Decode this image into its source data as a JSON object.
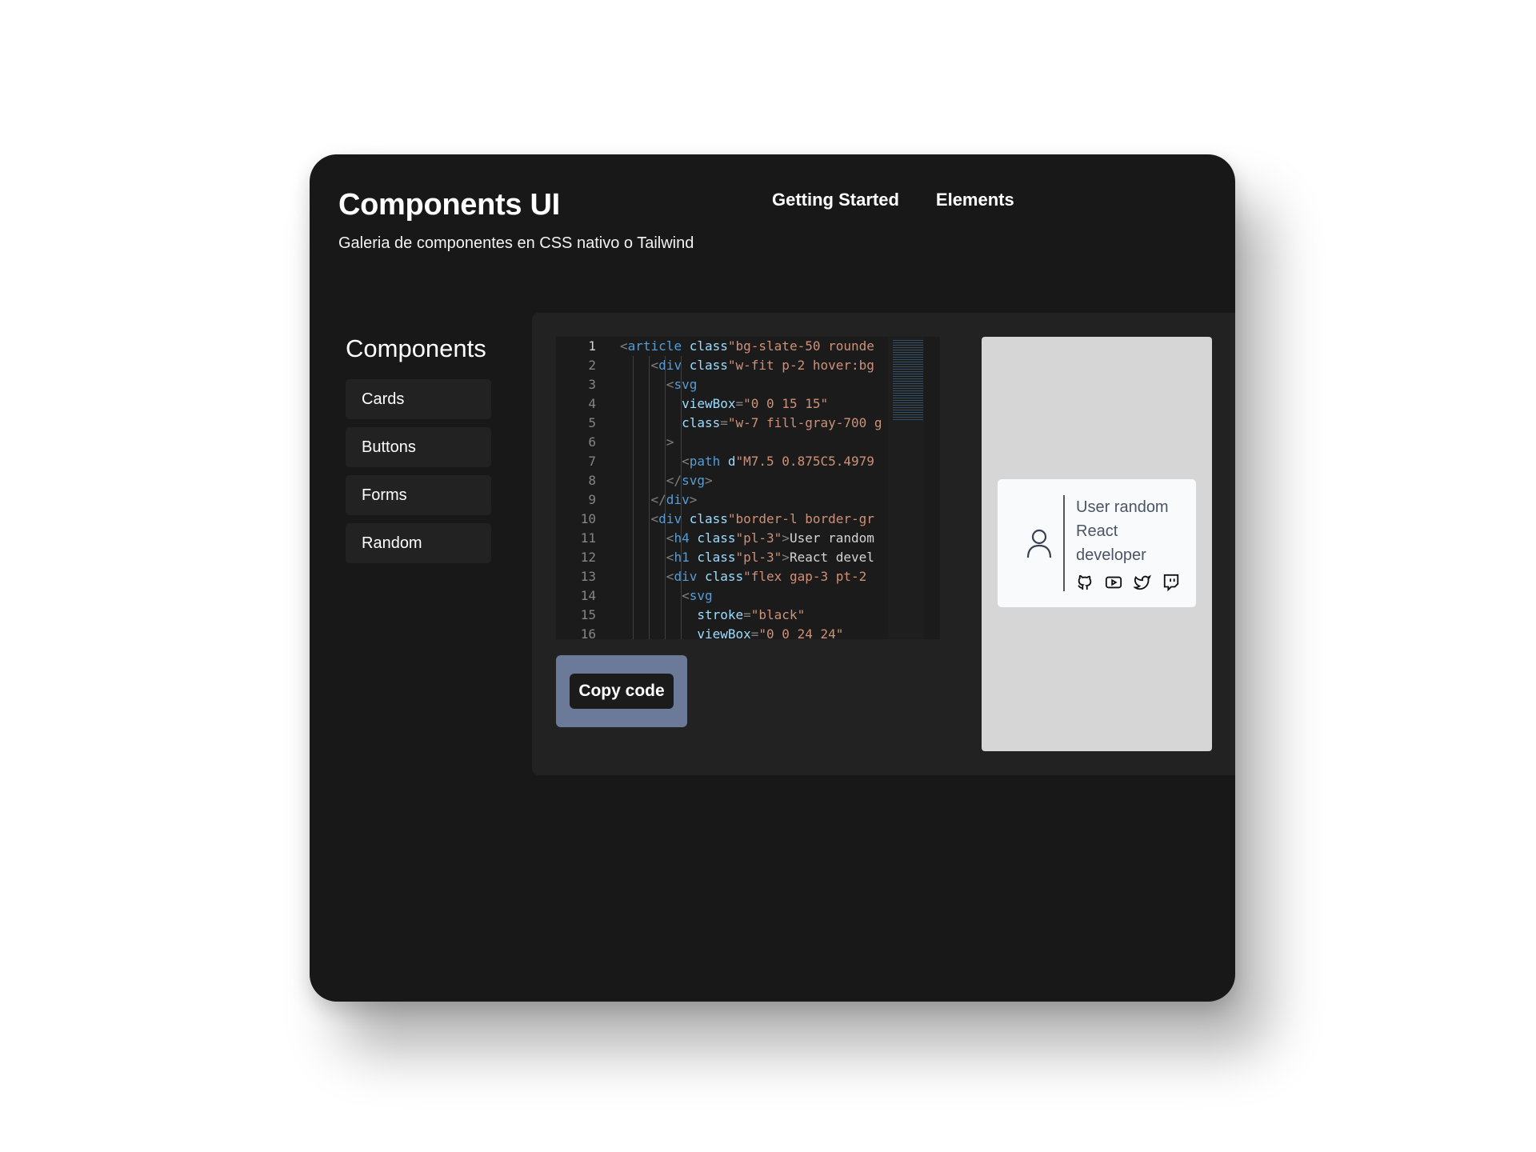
{
  "header": {
    "title": "Components UI",
    "subtitle": "Galeria de componentes en CSS nativo o Tailwind"
  },
  "nav": [
    {
      "label": "Getting Started"
    },
    {
      "label": "Elements"
    }
  ],
  "sidebar": {
    "heading": "Components",
    "items": [
      {
        "label": "Cards"
      },
      {
        "label": "Buttons"
      },
      {
        "label": "Forms"
      },
      {
        "label": "Random"
      }
    ]
  },
  "code": {
    "lines": [
      {
        "n": "1",
        "text": "<article class=\"bg-slate-50 rounde"
      },
      {
        "n": "2",
        "text": "    <div class=\"w-fit p-2 hover:bg"
      },
      {
        "n": "3",
        "text": "      <svg"
      },
      {
        "n": "4",
        "text": "        viewBox=\"0 0 15 15\""
      },
      {
        "n": "5",
        "text": "        class=\"w-7 fill-gray-700 g"
      },
      {
        "n": "6",
        "text": "      >"
      },
      {
        "n": "7",
        "text": "        <path d=\"M7.5 0.875C5.4979"
      },
      {
        "n": "8",
        "text": "      </svg>"
      },
      {
        "n": "9",
        "text": "    </div>"
      },
      {
        "n": "10",
        "text": "    <div class=\"border-l border-gr"
      },
      {
        "n": "11",
        "text": "      <h4 class=\"pl-3\">User random"
      },
      {
        "n": "12",
        "text": "      <h1 class=\"pl-3\">React devel"
      },
      {
        "n": "13",
        "text": "      <div class=\"flex gap-3 pt-2"
      },
      {
        "n": "14",
        "text": "        <svg"
      },
      {
        "n": "15",
        "text": "          stroke=\"black\""
      },
      {
        "n": "16",
        "text": "          viewBox=\"0 0 24 24\""
      }
    ]
  },
  "copy_button": {
    "label": "Copy code"
  },
  "preview_card": {
    "name": "User random",
    "role": "React developer",
    "icons": [
      "github-icon",
      "youtube-icon",
      "twitter-icon",
      "twitch-icon"
    ]
  },
  "colors": {
    "background": "#181818",
    "panel": "#222222",
    "accent": "#6b7a99",
    "preview_bg": "#d6d6d6",
    "card_bg": "#f8fafc"
  }
}
